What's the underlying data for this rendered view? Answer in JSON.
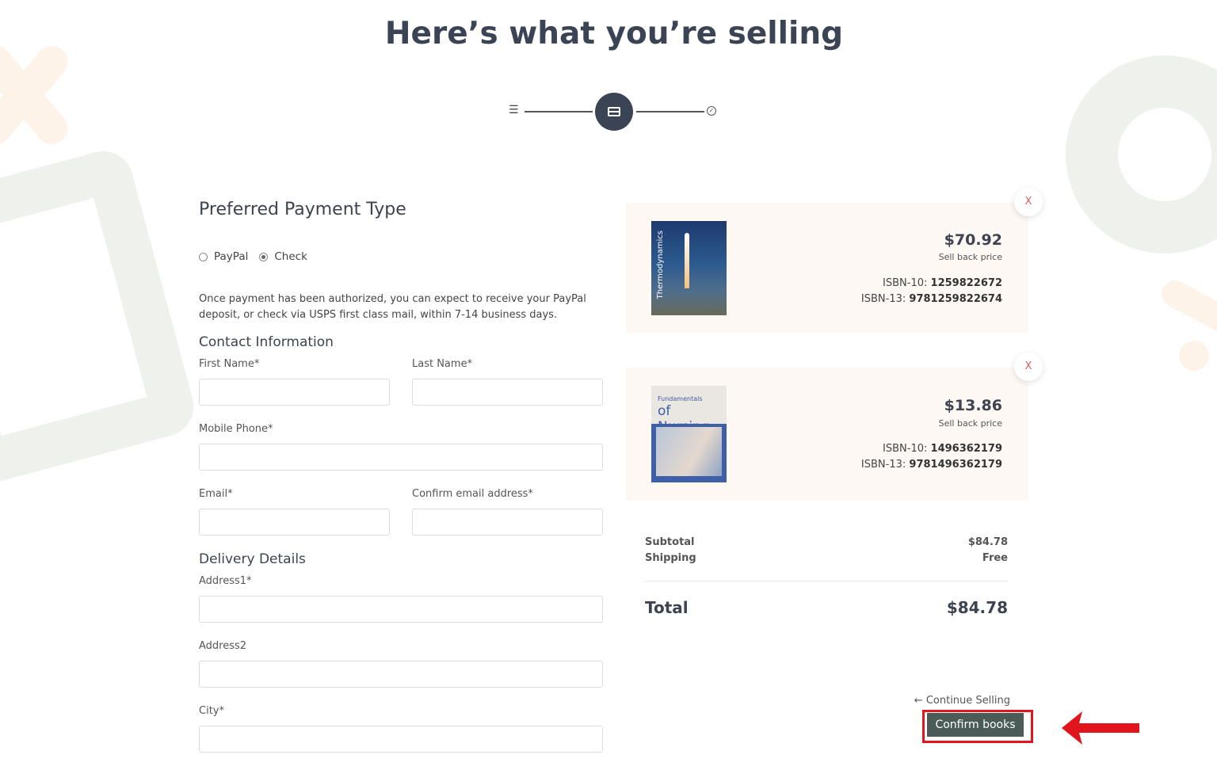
{
  "page_title": "Here’s what you’re selling",
  "stepper": {
    "list_icon": "list-icon",
    "current_icon": "credit-card-icon",
    "done_icon": "check-circle-icon",
    "done_glyph": "✓",
    "list_glyph": "☰"
  },
  "payment": {
    "heading": "Preferred Payment Type",
    "options": [
      "PayPal",
      "Check"
    ],
    "selected": "Check",
    "info": "Once payment has been authorized, you can expect to receive your PayPal deposit, or check via USPS first class mail, within 7-14 business days."
  },
  "contact": {
    "heading": "Contact Information",
    "first_name_label": "First Name*",
    "last_name_label": "Last Name*",
    "mobile_label": "Mobile Phone*",
    "email_label": "Email*",
    "confirm_email_label": "Confirm email address*"
  },
  "delivery": {
    "heading": "Delivery Details",
    "address1_label": "Address1*",
    "address2_label": "Address2",
    "city_label": "City*"
  },
  "cart": {
    "items": [
      {
        "remove_label": "X",
        "cover_title": "Thermodynamics",
        "price": "$70.92",
        "price_label": "Sell back price",
        "isbn10_label": "ISBN-10:",
        "isbn10": "1259822672",
        "isbn13_label": "ISBN-13:",
        "isbn13": "9781259822674"
      },
      {
        "remove_label": "X",
        "cover_title_top": "Fundamentals",
        "cover_title": "of Nursing",
        "price": "$13.86",
        "price_label": "Sell back price",
        "isbn10_label": "ISBN-10:",
        "isbn10": "1496362179",
        "isbn13_label": "ISBN-13:",
        "isbn13": "9781496362179"
      }
    ]
  },
  "summary": {
    "subtotal_label": "Subtotal",
    "subtotal": "$84.78",
    "shipping_label": "Shipping",
    "shipping": "Free",
    "total_label": "Total",
    "total": "$84.78"
  },
  "actions": {
    "continue_label": "← Continue Selling",
    "confirm_label": "Confirm books"
  },
  "colors": {
    "primary": "#3b4455",
    "confirm_bg": "#4b5c58",
    "highlight": "#e0151d",
    "remove": "#e05a5a",
    "card_bg": "#fdf8f3"
  }
}
